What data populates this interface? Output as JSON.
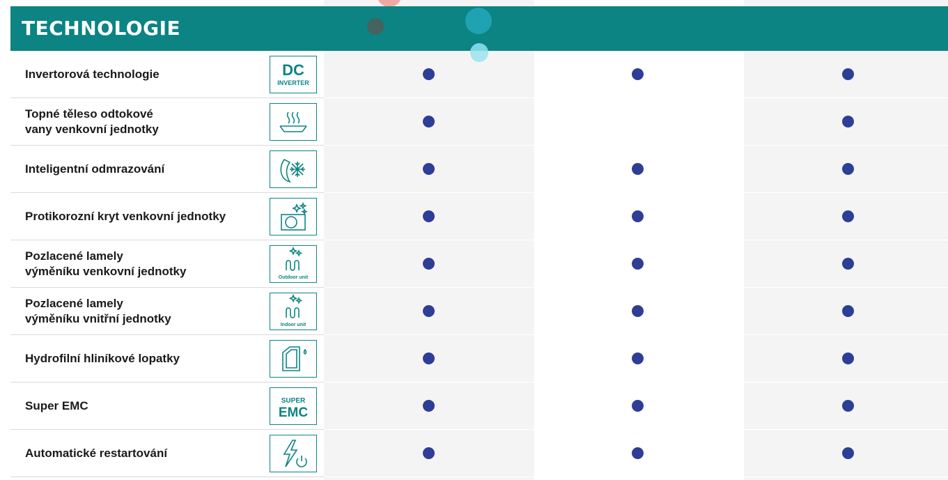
{
  "section": {
    "title": "TECHNOLOGIE"
  },
  "colors": {
    "header": "#0b8483",
    "dot": "#2e3d95",
    "column_tint": "#f4f4f4"
  },
  "rows": [
    {
      "label_lines": [
        "Invertorová technologie"
      ],
      "icon": "dc-inverter-icon",
      "icon_text": [
        "DC",
        "INVERTER"
      ],
      "features": [
        true,
        true,
        true
      ]
    },
    {
      "label_lines": [
        "Topné těleso odtokové",
        "vany venkovní jednotky"
      ],
      "icon": "heating-tray-icon",
      "icon_text": [],
      "features": [
        true,
        false,
        true
      ]
    },
    {
      "label_lines": [
        "Inteligentní odmrazování"
      ],
      "icon": "defrost-icon",
      "icon_text": [],
      "features": [
        true,
        true,
        true
      ]
    },
    {
      "label_lines": [
        "Protikorozní kryt venkovní jednotky"
      ],
      "icon": "anticorrosion-cover-icon",
      "icon_text": [],
      "features": [
        true,
        true,
        true
      ]
    },
    {
      "label_lines": [
        "Pozlacené lamely",
        "výměníku venkovní jednotky"
      ],
      "icon": "golden-fin-outdoor-icon",
      "icon_text": [
        "Outdoor unit"
      ],
      "features": [
        true,
        true,
        true
      ]
    },
    {
      "label_lines": [
        "Pozlacené lamely",
        "výměníku vnitřní jednotky"
      ],
      "icon": "golden-fin-indoor-icon",
      "icon_text": [
        "Indoor unit"
      ],
      "features": [
        true,
        true,
        true
      ]
    },
    {
      "label_lines": [
        "Hydrofilní hliníkové lopatky"
      ],
      "icon": "hydrophilic-fin-icon",
      "icon_text": [],
      "features": [
        true,
        true,
        true
      ]
    },
    {
      "label_lines": [
        "Super EMC"
      ],
      "icon": "super-emc-icon",
      "icon_text": [
        "SUPER",
        "EMC"
      ],
      "features": [
        true,
        true,
        true
      ]
    },
    {
      "label_lines": [
        "Automatické restartování"
      ],
      "icon": "auto-restart-icon",
      "icon_text": [],
      "features": [
        true,
        true,
        true
      ]
    }
  ]
}
